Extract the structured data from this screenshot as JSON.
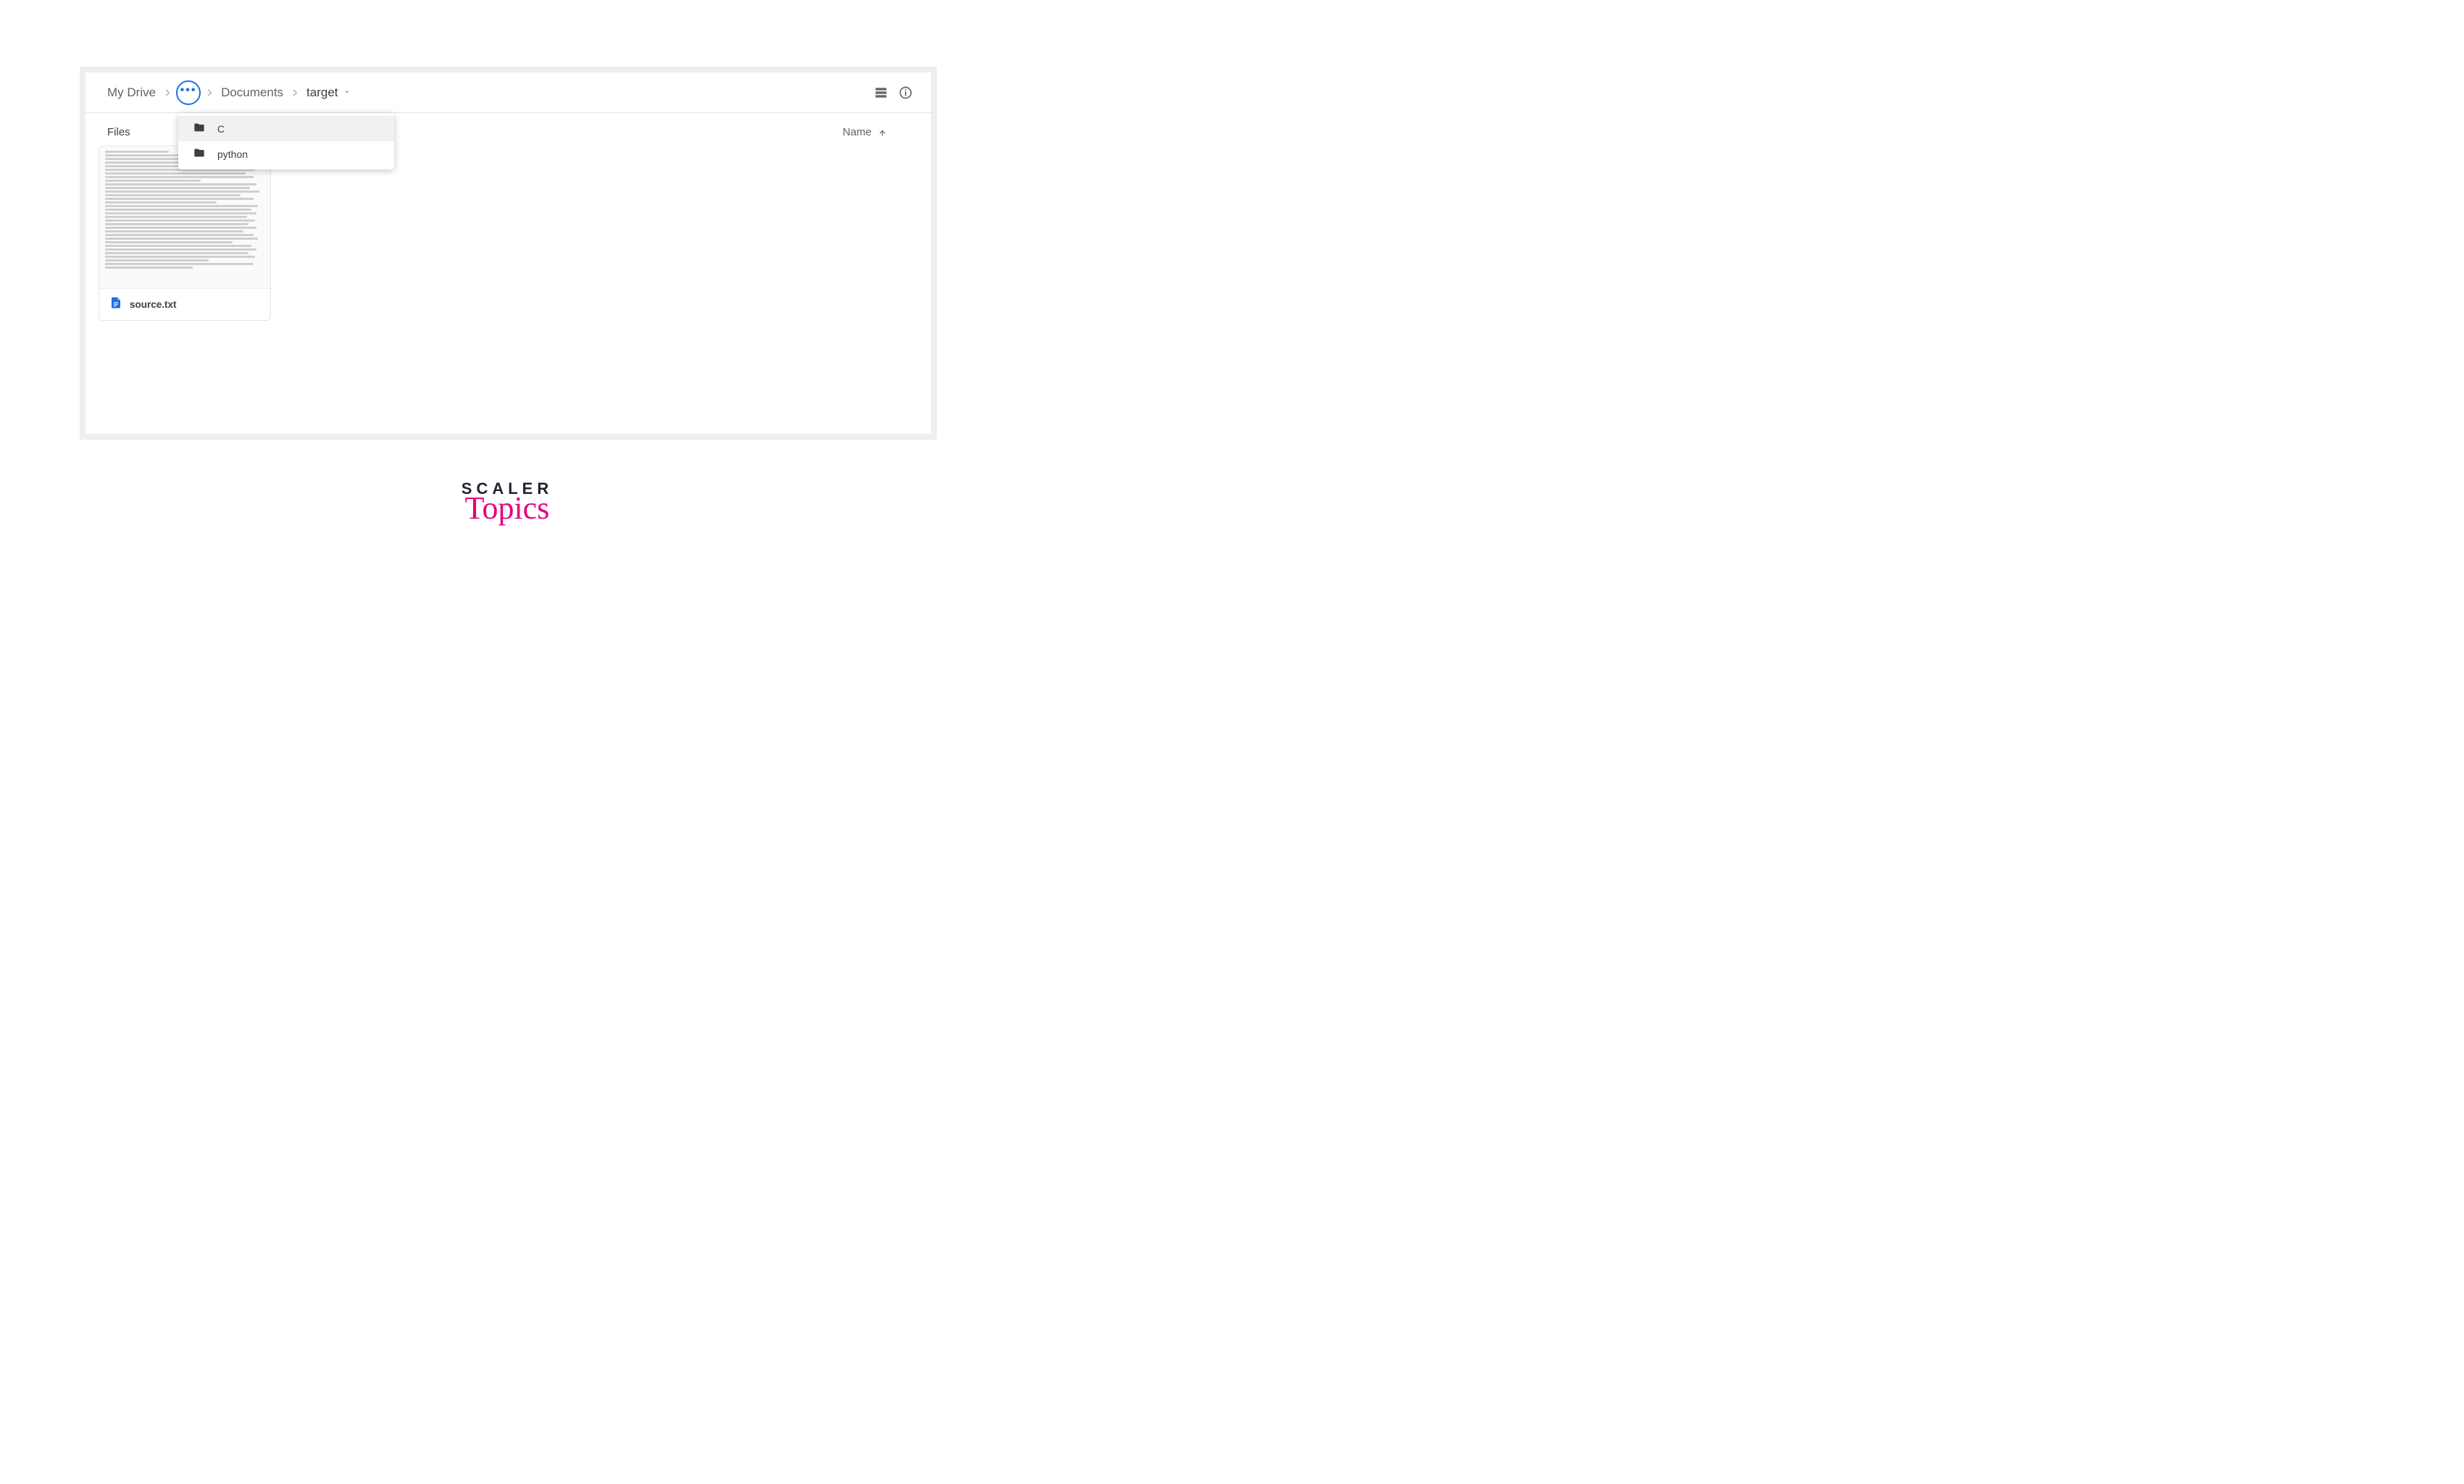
{
  "breadcrumb": {
    "root": "My Drive",
    "ellipsis": "•••",
    "documents": "Documents",
    "current": "target"
  },
  "section": {
    "files_label": "Files",
    "sort_label": "Name"
  },
  "folder_menu": {
    "items": [
      {
        "label": "C"
      },
      {
        "label": "python"
      }
    ]
  },
  "files": [
    {
      "name": "source.txt"
    }
  ],
  "logo": {
    "line1": "SCALER",
    "line2": "Topics"
  }
}
